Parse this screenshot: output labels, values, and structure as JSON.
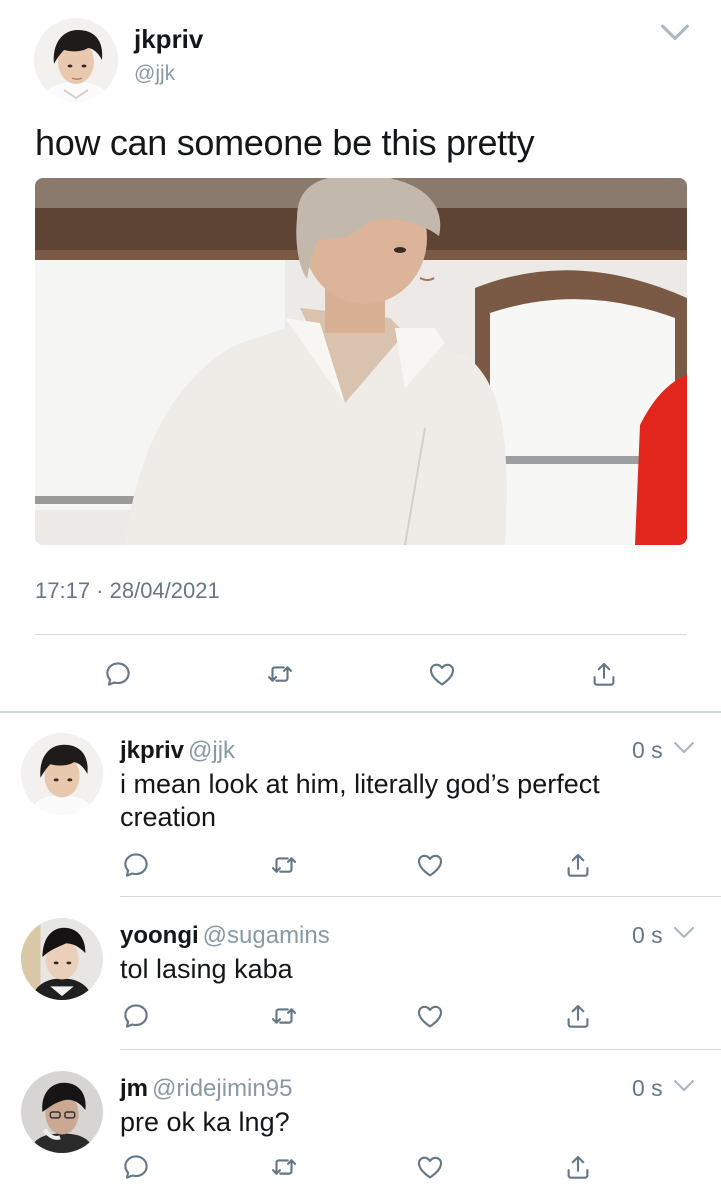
{
  "main_tweet": {
    "name": "jkpriv",
    "handle": "@jjk",
    "text": "how can someone be this pretty",
    "timestamp": "17:17 · 28/04/2021",
    "icons": {
      "menu": "chevron-down-icon",
      "reply": "reply-bubble-icon",
      "retweet": "retweet-icon",
      "like": "heart-icon",
      "share": "share-icon"
    }
  },
  "replies": [
    {
      "name": "jkpriv",
      "handle": "@jjk",
      "time": "0 s",
      "text": "i mean look at him, literally god’s perfect creation"
    },
    {
      "name": "yoongi",
      "handle": "@sugamins",
      "time": "0 s",
      "text": "tol lasing kaba"
    },
    {
      "name": "jm",
      "handle": "@ridejimin95",
      "time": "0 s",
      "text": "pre ok ka lng?"
    }
  ],
  "colors": {
    "text": "#14171a",
    "secondary": "#657786",
    "icon": "#657786",
    "divider": "#d3d9de"
  }
}
